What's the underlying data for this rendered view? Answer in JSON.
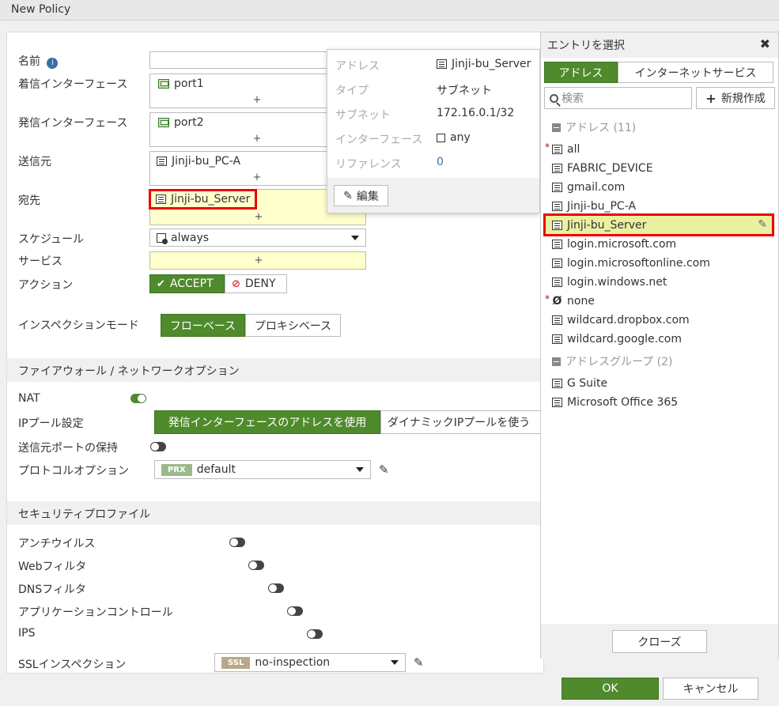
{
  "window": {
    "title": "New Policy"
  },
  "form": {
    "name_label": "名前",
    "in_if_label": "着信インターフェース",
    "in_if_value": "port1",
    "out_if_label": "発信インターフェース",
    "out_if_value": "port2",
    "src_label": "送信元",
    "src_value": "Jinji-bu_PC-A",
    "dst_label": "宛先",
    "dst_value": "Jinji-bu_Server",
    "schedule_label": "スケジュール",
    "schedule_value": "always",
    "service_label": "サービス",
    "action_label": "アクション",
    "accept_label": "ACCEPT",
    "deny_label": "DENY",
    "inspection_label": "インスペクションモード",
    "flow_label": "フローベース",
    "proxy_label": "プロキシベース",
    "plus": "+"
  },
  "fw_section": {
    "title": "ファイアウォール / ネットワークオプション",
    "nat_label": "NAT",
    "ippool_label": "IPプール設定",
    "ippool_opt1": "発信インターフェースのアドレスを使用",
    "ippool_opt2": "ダイナミックIPプールを使う",
    "preserve_label": "送信元ポートの保持",
    "protocol_label": "プロトコルオプション",
    "protocol_pill": "PRX",
    "protocol_value": "default"
  },
  "sec_section": {
    "title": "セキュリティプロファイル",
    "antivirus": "アンチウイルス",
    "webfilter": "Webフィルタ",
    "dnsfilter": "DNSフィルタ",
    "appcontrol": "アプリケーションコントロール",
    "ips": "IPS",
    "ssl_label": "SSLインスペクション",
    "ssl_pill": "SSL",
    "ssl_value": "no-inspection"
  },
  "tooltip": {
    "address_k": "アドレス",
    "address_v": "Jinji-bu_Server",
    "type_k": "タイプ",
    "type_v": "サブネット",
    "subnet_k": "サブネット",
    "subnet_v": "172.16.0.1/32",
    "iface_k": "インターフェース",
    "iface_v": "any",
    "ref_k": "リファレンス",
    "ref_v": "0",
    "edit_label": "編集"
  },
  "panel": {
    "title": "エントリを選択",
    "tab_address": "アドレス",
    "tab_internet": "インターネットサービス",
    "search_placeholder": "検索",
    "new_label": "新規作成",
    "group1": "アドレス (11)",
    "items": [
      "all",
      "FABRIC_DEVICE",
      "gmail.com",
      "Jinji-bu_PC-A",
      "Jinji-bu_Server",
      "login.microsoft.com",
      "login.microsoftonline.com",
      "login.windows.net",
      "none",
      "wildcard.dropbox.com",
      "wildcard.google.com"
    ],
    "group2": "アドレスグループ (2)",
    "group_items": [
      "G Suite",
      "Microsoft Office 365"
    ],
    "close_label": "クローズ"
  },
  "footer": {
    "ok_label": "OK",
    "cancel_label": "キャンセル"
  },
  "colors": {
    "accent_green": "#4f8a2c",
    "highlight_red": "#e00000",
    "selected_yellow": "#eaf0a0"
  }
}
